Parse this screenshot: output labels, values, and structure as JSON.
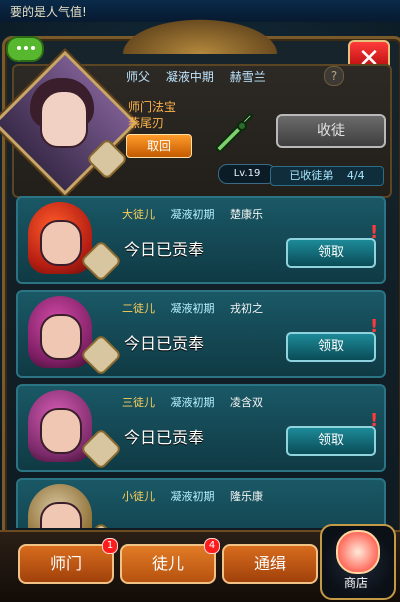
{
  "ticker": {
    "text": "要的是人气值!"
  },
  "header": {
    "close_icon": "close-x"
  },
  "master": {
    "label": "师父",
    "realm": "凝液中期",
    "name": "赫雪兰",
    "help": "?",
    "treasure_title": "师门法宝",
    "treasure_name": "燕尾刃",
    "retrieve_label": "取回",
    "level": "Lv.19",
    "accept_label": "收徒",
    "disciple_count_label": "已收徒弟",
    "disciple_count": "4/4"
  },
  "disciples": [
    {
      "rank": "大徒儿",
      "realm": "凝液初期",
      "name": "楚康乐",
      "tribute": "今日已贡奉",
      "claim": "领取",
      "alert": "!"
    },
    {
      "rank": "二徒儿",
      "realm": "凝液初期",
      "name": "戎初之",
      "tribute": "今日已贡奉",
      "claim": "领取",
      "alert": "!"
    },
    {
      "rank": "三徒儿",
      "realm": "凝液初期",
      "name": "凌含双",
      "tribute": "今日已贡奉",
      "claim": "领取",
      "alert": "!"
    },
    {
      "rank": "小徒儿",
      "realm": "凝液初期",
      "name": "隆乐康",
      "tribute": "",
      "claim": "",
      "alert": ""
    }
  ],
  "bottom": {
    "tabs": [
      {
        "label": "师门",
        "badge": "1"
      },
      {
        "label": "徒儿",
        "badge": "4"
      },
      {
        "label": "通缉",
        "badge": ""
      }
    ],
    "shop_label": "商店"
  }
}
